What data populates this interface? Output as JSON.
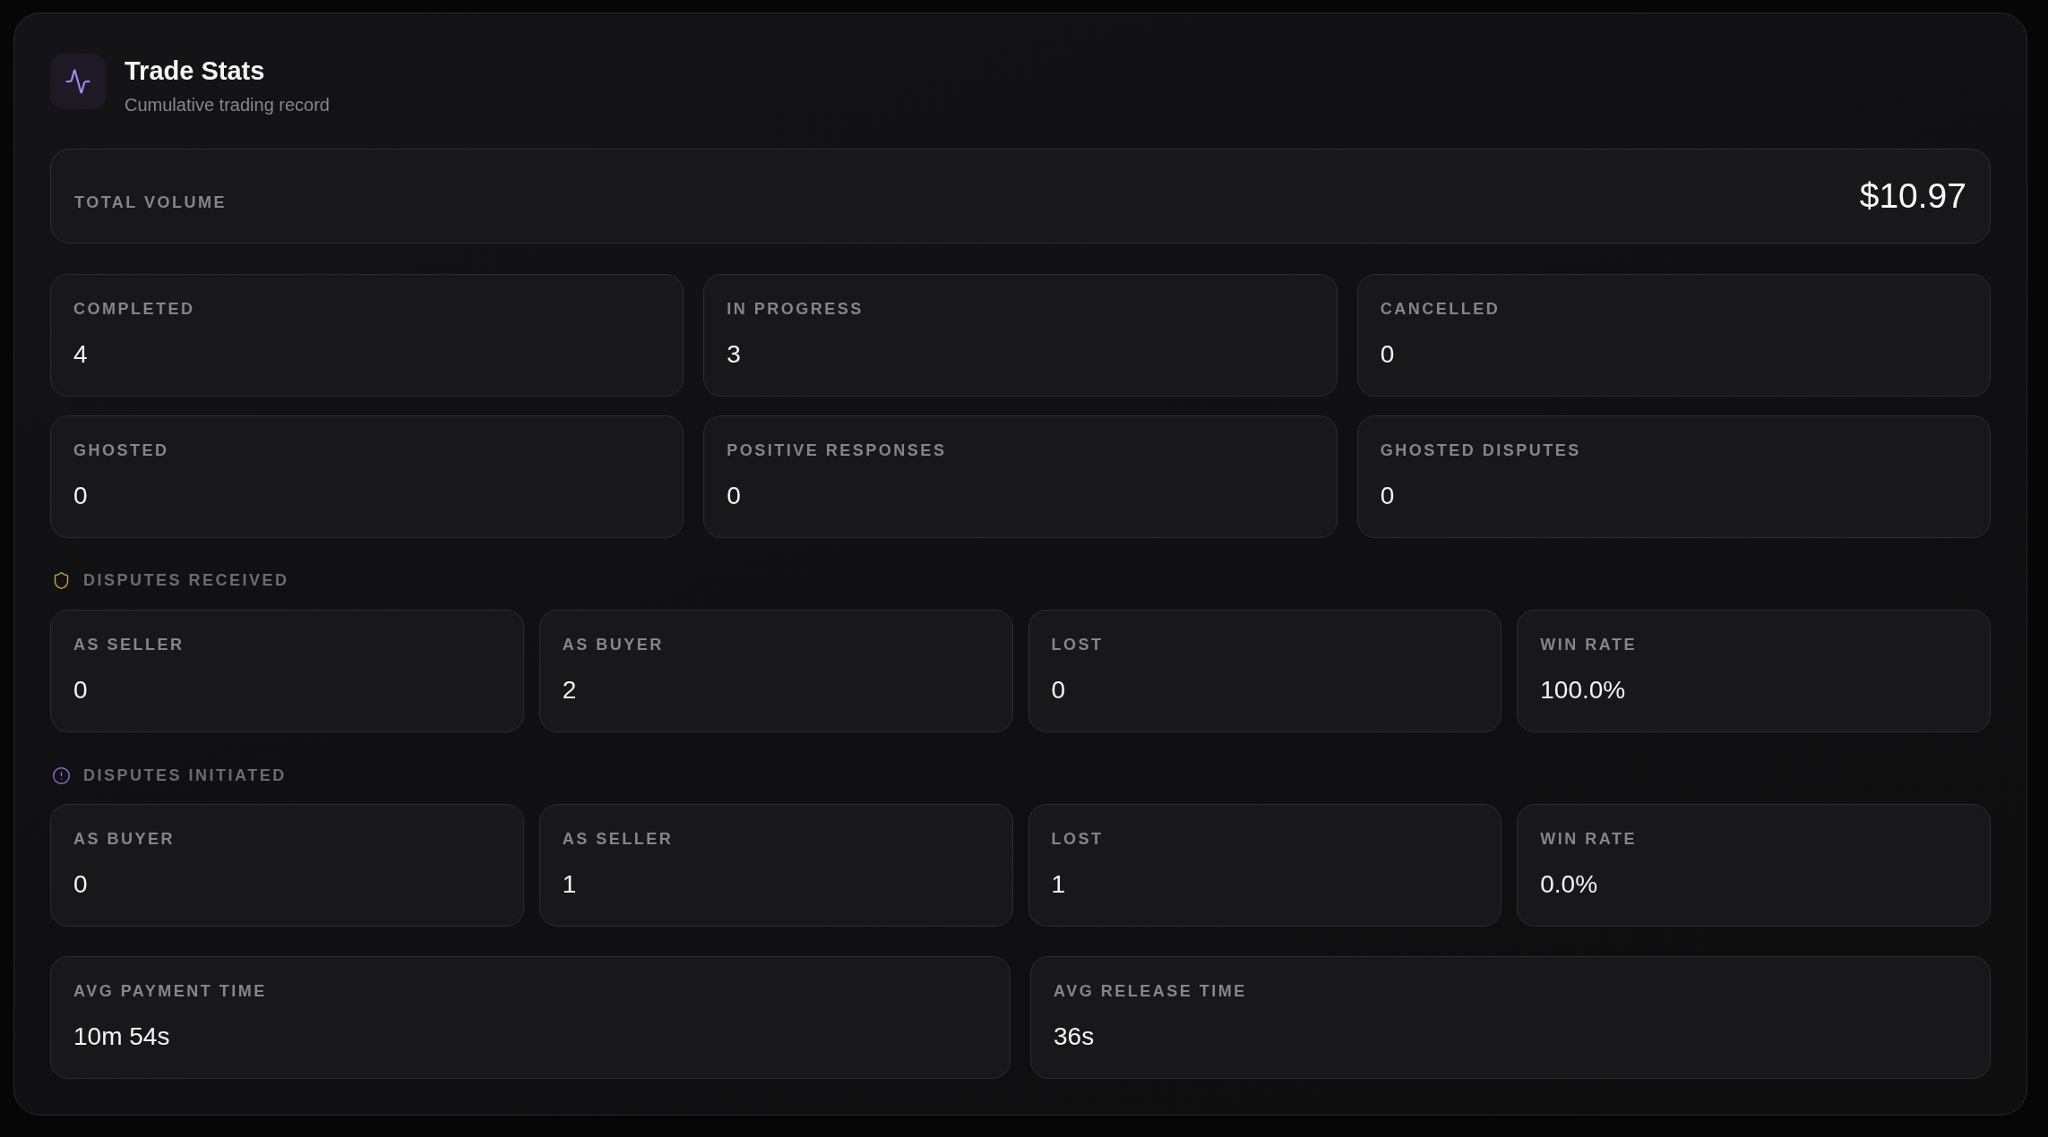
{
  "header": {
    "title": "Trade Stats",
    "subtitle": "Cumulative trading record"
  },
  "total_volume": {
    "label": "TOTAL VOLUME",
    "value": "$10.97"
  },
  "stats": [
    {
      "label": "COMPLETED",
      "value": "4"
    },
    {
      "label": "IN PROGRESS",
      "value": "3"
    },
    {
      "label": "CANCELLED",
      "value": "0"
    },
    {
      "label": "GHOSTED",
      "value": "0"
    },
    {
      "label": "POSITIVE RESPONSES",
      "value": "0"
    },
    {
      "label": "GHOSTED DISPUTES",
      "value": "0"
    }
  ],
  "sections": [
    {
      "kind": "shield",
      "title": "DISPUTES RECEIVED",
      "items": [
        {
          "label": "AS SELLER",
          "value": "0"
        },
        {
          "label": "AS BUYER",
          "value": "2"
        },
        {
          "label": "LOST",
          "value": "0"
        },
        {
          "label": "WIN RATE",
          "value": "100.0%"
        }
      ]
    },
    {
      "kind": "alert",
      "title": "DISPUTES INITIATED",
      "items": [
        {
          "label": "AS BUYER",
          "value": "0"
        },
        {
          "label": "AS SELLER",
          "value": "1"
        },
        {
          "label": "LOST",
          "value": "1"
        },
        {
          "label": "WIN RATE",
          "value": "0.0%"
        }
      ]
    }
  ],
  "timings": [
    {
      "label": "AVG PAYMENT TIME",
      "value": "10m 54s"
    },
    {
      "label": "AVG RELEASE TIME",
      "value": "36s"
    }
  ]
}
